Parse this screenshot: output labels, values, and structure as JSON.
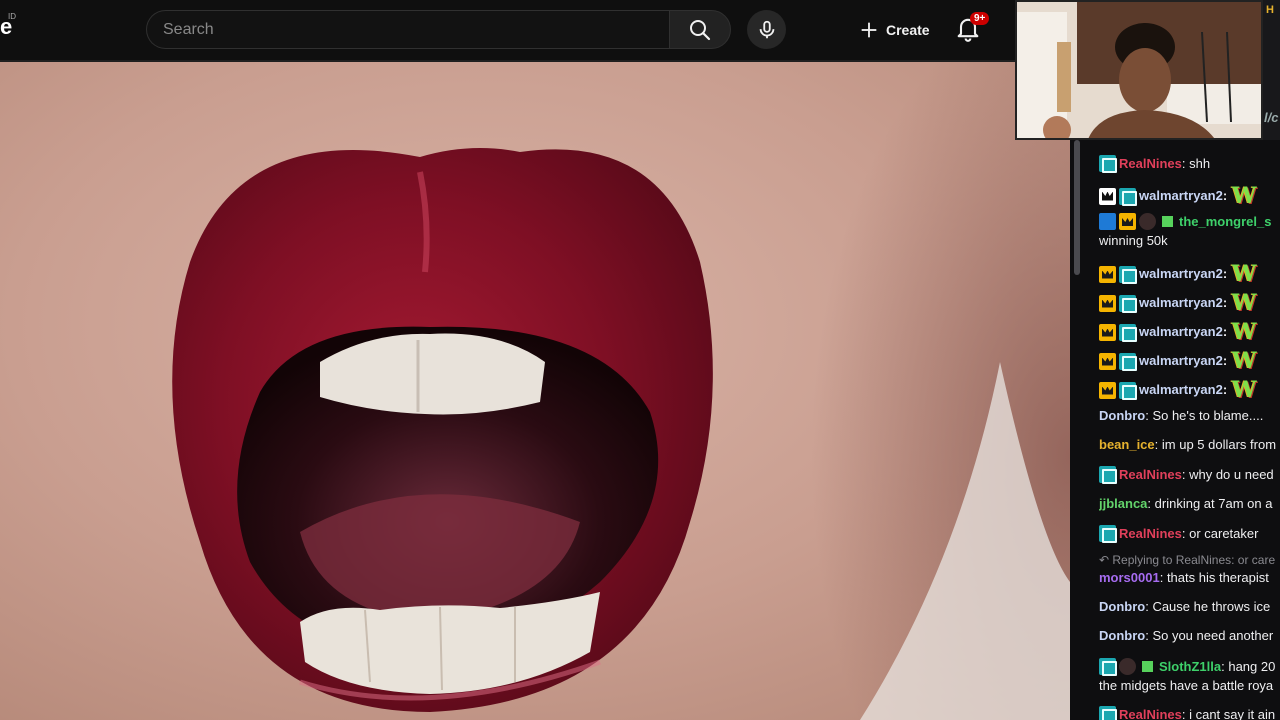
{
  "header": {
    "logo_fragment": "e",
    "logo_superscript": "ID",
    "search_placeholder": "Search",
    "create_label": "Create",
    "notification_count": "9+"
  },
  "chat": {
    "top_strip_fragment": "H",
    "top_strip_fragment2": "l/c",
    "messages": [
      {
        "badges": [
          "sub"
        ],
        "name": "RealNines",
        "name_color": "#e0405b",
        "text": ": shh"
      },
      {
        "badges": [
          "white",
          "sub"
        ],
        "name": "walmartryan2",
        "name_color": "#c9d6f5",
        "text": ":",
        "emote": "W"
      },
      {
        "badges": [
          "prime",
          "crown",
          "mask",
          "gift"
        ],
        "name": "the_mongrel_s",
        "name_color": "#3ed06a",
        "text": "",
        "continuation": "winning 50k"
      },
      {
        "badges": [
          "crown",
          "sub"
        ],
        "name": "walmartryan2",
        "name_color": "#c9d6f5",
        "text": ":",
        "emote": "W"
      },
      {
        "badges": [
          "crown",
          "sub"
        ],
        "name": "walmartryan2",
        "name_color": "#c9d6f5",
        "text": ":",
        "emote": "W"
      },
      {
        "badges": [
          "crown",
          "sub"
        ],
        "name": "walmartryan2",
        "name_color": "#c9d6f5",
        "text": ":",
        "emote": "W"
      },
      {
        "badges": [
          "crown",
          "sub"
        ],
        "name": "walmartryan2",
        "name_color": "#c9d6f5",
        "text": ":",
        "emote": "W"
      },
      {
        "badges": [
          "crown",
          "sub"
        ],
        "name": "walmartryan2",
        "name_color": "#c9d6f5",
        "text": ":",
        "emote": "W"
      },
      {
        "badges": [],
        "name": "Donbro",
        "name_color": "#c9d6f5",
        "text": ": So he's to blame...."
      },
      {
        "badges": [],
        "name": "bean_ice",
        "name_color": "#e6b22e",
        "text": ": im up 5 dollars from"
      },
      {
        "badges": [
          "sub"
        ],
        "name": "RealNines",
        "name_color": "#e0405b",
        "text": ": why do u need"
      },
      {
        "badges": [],
        "name": "jjblanca",
        "name_color": "#63d36b",
        "text": ": drinking at 7am on a"
      },
      {
        "badges": [
          "sub"
        ],
        "name": "RealNines",
        "name_color": "#e0405b",
        "text": ": or caretaker"
      },
      {
        "badges": [],
        "name": "mors0001",
        "name_color": "#a66cf0",
        "text": ": thats his therapist",
        "reply": "Replying to RealNines: or care"
      },
      {
        "badges": [],
        "name": "Donbro",
        "name_color": "#c9d6f5",
        "text": ": Cause he throws ice"
      },
      {
        "badges": [],
        "name": "Donbro",
        "name_color": "#c9d6f5",
        "text": ": So you need another"
      },
      {
        "badges": [
          "sub",
          "mask",
          "gift"
        ],
        "name": "SlothZ1lla",
        "name_color": "#3ed06a",
        "text": ": hang 20",
        "continuation": "the midgets have a battle roya"
      },
      {
        "badges": [
          "sub"
        ],
        "name": "RealNines",
        "name_color": "#e0405b",
        "text": ": i cant say it ain"
      }
    ]
  },
  "colors": {
    "background": "#0f0f0f",
    "chat_background": "#0e0e10",
    "sub_badge": "#1ba7b0",
    "crown_badge": "#f5b400",
    "notification_red": "#cc0000"
  }
}
